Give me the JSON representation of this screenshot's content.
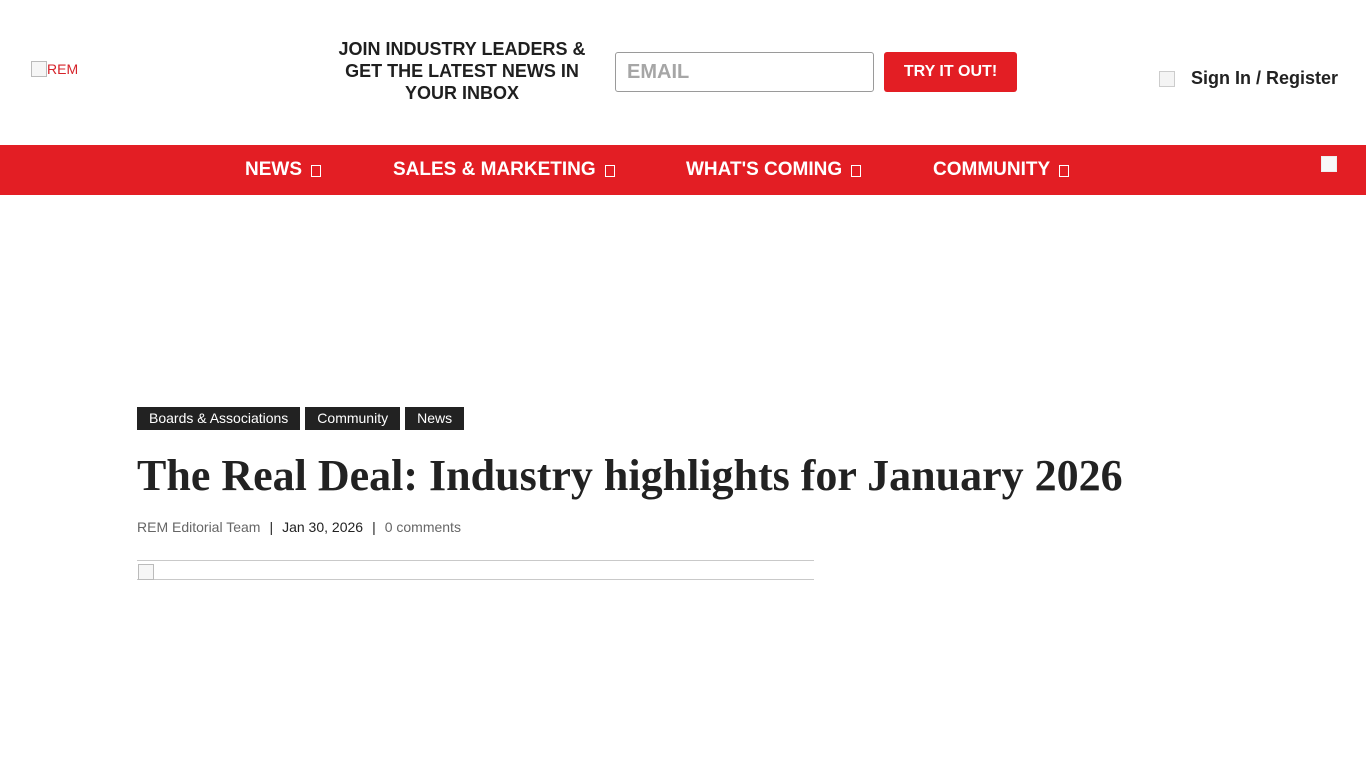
{
  "header": {
    "logo_alt": "REM",
    "promo_text": "JOIN INDUSTRY LEADERS & GET THE LATEST NEWS IN YOUR INBOX",
    "email_placeholder": "EMAIL",
    "cta_label": "TRY IT OUT!",
    "signin_label": "Sign In / Register"
  },
  "nav": {
    "items": [
      {
        "label": "NEWS"
      },
      {
        "label": "SALES & MARKETING"
      },
      {
        "label": "WHAT'S COMING"
      },
      {
        "label": "COMMUNITY"
      }
    ]
  },
  "article": {
    "tags": [
      "Boards & Associations",
      "Community",
      "News"
    ],
    "title": "The Real Deal: Industry highlights for January 2026",
    "author": "REM Editorial Team",
    "date": "Jan 30, 2026",
    "comments": "0 comments"
  },
  "colors": {
    "brand_red": "#e31e24",
    "tag_bg": "#222222"
  }
}
